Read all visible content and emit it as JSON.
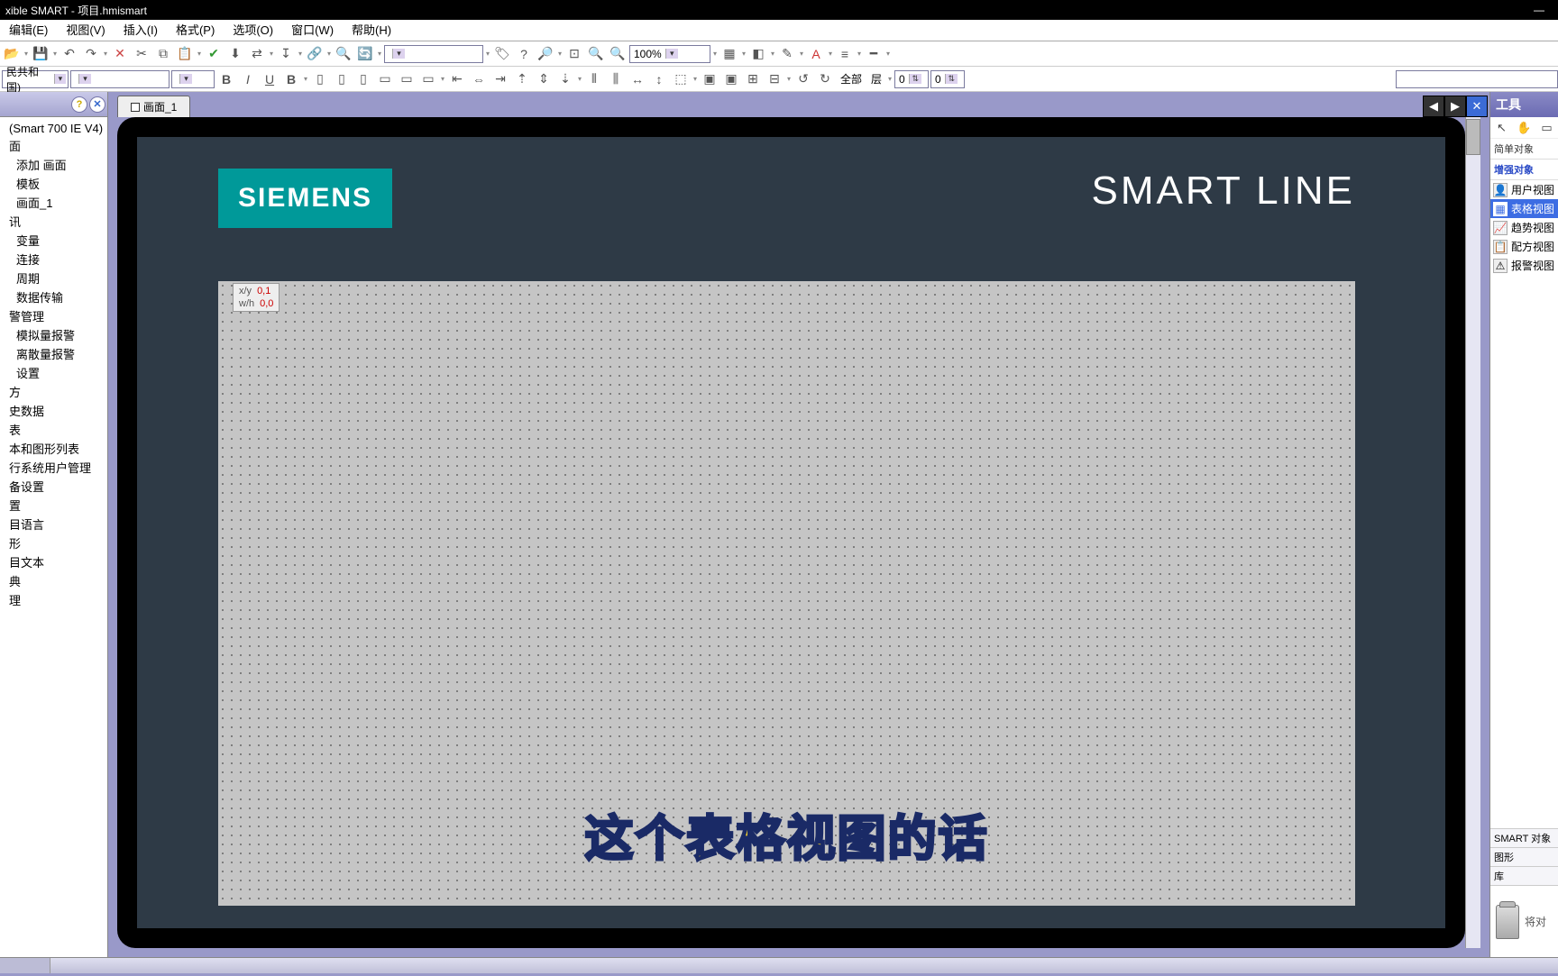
{
  "title": "xible SMART - 项目.hmismart",
  "window_buttons": {
    "minimize": "—"
  },
  "menu": [
    "编辑(E)",
    "视图(V)",
    "插入(I)",
    "格式(P)",
    "选项(O)",
    "窗口(W)",
    "帮助(H)"
  ],
  "toolbar1": {
    "zoom": "100%",
    "labels": {
      "all": "全部",
      "layer": "层"
    },
    "spin1": "0",
    "spin2": "0"
  },
  "toolbar2": {
    "lang": "民共和国)",
    "combo2": "",
    "combo3": ""
  },
  "left_panel": {
    "header_help": "?",
    "header_close": "✕",
    "nodes": [
      {
        "t": "(Smart 700 IE V4)",
        "i": 0
      },
      {
        "t": "面",
        "i": 0
      },
      {
        "t": "添加 画面",
        "i": 1
      },
      {
        "t": "模板",
        "i": 1
      },
      {
        "t": "画面_1",
        "i": 1
      },
      {
        "t": "讯",
        "i": 0
      },
      {
        "t": "变量",
        "i": 1
      },
      {
        "t": "连接",
        "i": 1
      },
      {
        "t": "周期",
        "i": 1
      },
      {
        "t": "数据传输",
        "i": 1
      },
      {
        "t": "警管理",
        "i": 0
      },
      {
        "t": "模拟量报警",
        "i": 1
      },
      {
        "t": "离散量报警",
        "i": 1
      },
      {
        "t": "设置",
        "i": 1
      },
      {
        "t": "方",
        "i": 0
      },
      {
        "t": "史数据",
        "i": 0
      },
      {
        "t": "表",
        "i": 0
      },
      {
        "t": "本和图形列表",
        "i": 0
      },
      {
        "t": "行系统用户管理",
        "i": 0
      },
      {
        "t": "备设置",
        "i": 0
      },
      {
        "t": "置",
        "i": 0
      },
      {
        "t": "目语言",
        "i": 0
      },
      {
        "t": "形",
        "i": 0
      },
      {
        "t": "目文本",
        "i": 0
      },
      {
        "t": "典",
        "i": 0
      },
      {
        "t": "理",
        "i": 0
      }
    ]
  },
  "tabs": {
    "current": "画面_1",
    "nav_prev": "◀",
    "nav_next": "▶",
    "nav_close": "✕"
  },
  "device": {
    "logo": "SIEMENS",
    "product": "SMART LINE",
    "coords": {
      "xy_label": "x/y",
      "xy_val": "0,1",
      "wh_label": "w/h",
      "wh_val": "0,0"
    }
  },
  "subtitle_overlay": "这个表格视图的话",
  "right_panel": {
    "title": "工具",
    "section_simple": "简单对象",
    "section_enhanced": "增强对象",
    "items": [
      {
        "icon": "👤",
        "label": "用户视图",
        "sel": false
      },
      {
        "icon": "▦",
        "label": "表格视图",
        "sel": true
      },
      {
        "icon": "📈",
        "label": "趋势视图",
        "sel": false
      },
      {
        "icon": "📋",
        "label": "配方视图",
        "sel": false
      },
      {
        "icon": "⚠",
        "label": "报警视图",
        "sel": false
      }
    ],
    "smart_section": "SMART 对象",
    "graphics": "图形",
    "library": "库",
    "dropzone": "将对"
  }
}
